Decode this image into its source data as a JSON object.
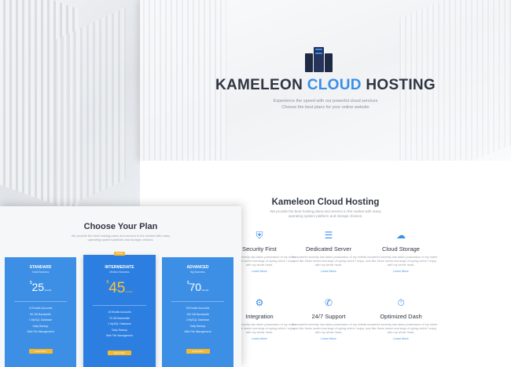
{
  "colors": {
    "accent": "#3a8fe8",
    "heading": "#2f3542",
    "card": "#3d8fe6",
    "button": "#f5b82e"
  },
  "hero": {
    "title_part1": "KAMELEON",
    "title_accent": "CLOUD",
    "title_part2": "HOSTING",
    "subtitle_line1": "Experience the speed with our powerful cloud services",
    "subtitle_line2": "Choose the best plans for your online website",
    "icon": "server-rack-icon"
  },
  "features": {
    "heading": "Kameleon Cloud Hosting",
    "sub_line1": "We provide the best hosting plans and servers in the market with many",
    "sub_line2": "operating system platform and storage choices.",
    "description": "A wonderful serenity has taken possession of my entire soul like these sweet mornings of spring which I enjoy with my whole heart.",
    "learn_more": "Learn More",
    "items": [
      {
        "name": "Security First",
        "icon": "shield-icon"
      },
      {
        "name": "Dedicated Server",
        "icon": "server-icon"
      },
      {
        "name": "Cloud Storage",
        "icon": "cloud-icon"
      },
      {
        "name": "Integration",
        "icon": "gears-icon"
      },
      {
        "name": "24/7 Support",
        "icon": "phone-icon"
      },
      {
        "name": "Optimized Dash",
        "icon": "dashboard-icon"
      }
    ]
  },
  "pricing": {
    "heading": "Choose Your Plan",
    "sub_line1": "We provide the best hosting plans and servers in the market with many",
    "sub_line2": "operating system platform and storage choices.",
    "popular_badge": "Popular",
    "plans": [
      {
        "name": "STANDARD",
        "sub": "Small Business",
        "currency": "$",
        "price": "25",
        "period": "/month",
        "features": [
          "10 Emails Accounts",
          "50 GB Bandwidth",
          "1 MySQL Database",
          "Daily Backup",
          "Web File Management"
        ],
        "button": "Select Plan"
      },
      {
        "name": "INTERMEDIATE",
        "sub": "Medium Business",
        "currency": "$",
        "price": "45",
        "period": "/month",
        "features": [
          "15 Emails Accounts",
          "75 GB Bandwidth",
          "1 MySQL Database",
          "Daily Backup",
          "Web File Management"
        ],
        "button": "Select Plan"
      },
      {
        "name": "ADVANCED",
        "sub": "Big Business",
        "currency": "$",
        "price": "70",
        "period": "/month",
        "features": [
          "25 Emails Accounts",
          "100 GB Bandwidth",
          "2 MySQL Database",
          "Daily Backup",
          "Web File Management"
        ],
        "button": "Select Plan"
      }
    ]
  }
}
